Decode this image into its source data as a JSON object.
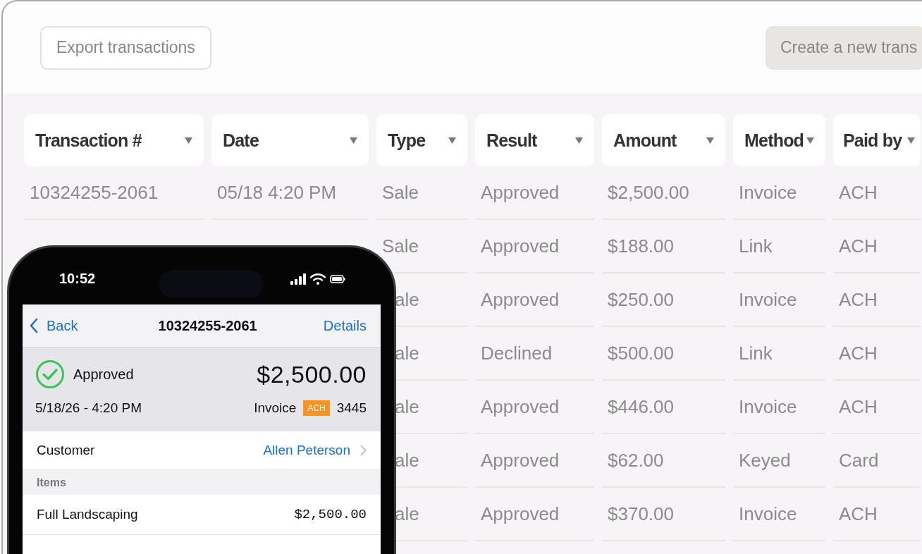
{
  "toolbar": {
    "buttons": [
      {
        "label": "Export transactions",
        "kind": "outline"
      },
      {
        "label": "Create a new trans",
        "kind": "filled"
      }
    ]
  },
  "table": {
    "columns": [
      "Transaction #",
      "Date",
      "Type",
      "Result",
      "Amount",
      "Method",
      "Paid by"
    ],
    "rows": [
      {
        "transaction": "10324255-2061",
        "date": "05/18 4:20 PM",
        "type": "Sale",
        "result": "Approved",
        "amount": "$2,500.00",
        "method": "Invoice",
        "paid_by": "ACH"
      },
      {
        "type": "Sale",
        "result": "Approved",
        "amount": "$188.00",
        "method": "Link",
        "paid_by": "ACH"
      },
      {
        "type": "ale",
        "result": "Approved",
        "amount": "$250.00",
        "method": "Invoice",
        "paid_by": "ACH"
      },
      {
        "type": "ale",
        "result": "Declined",
        "amount": "$500.00",
        "method": "Link",
        "paid_by": "ACH"
      },
      {
        "type": "ale",
        "result": "Approved",
        "amount": "$446.00",
        "method": "Invoice",
        "paid_by": "ACH"
      },
      {
        "type": "ale",
        "result": "Approved",
        "amount": "$62.00",
        "method": "Keyed",
        "paid_by": "Card"
      },
      {
        "type": "ale",
        "result": "Approved",
        "amount": "$370.00",
        "method": "Invoice",
        "paid_by": "ACH"
      }
    ]
  },
  "phone": {
    "time": "10:52",
    "nav": {
      "back": "Back",
      "title": "10324255-2061",
      "action": "Details"
    },
    "summary": {
      "status": "Approved",
      "amount": "$2,500.00",
      "date": "5/18/26 - 4:20 PM",
      "method": "Invoice",
      "badge": "ACH",
      "number": "3445"
    },
    "customer": {
      "label": "Customer",
      "value": "Allen Peterson"
    },
    "items_header": "Items",
    "items": [
      {
        "name": "Full Landscaping",
        "price": "$2,500.00"
      }
    ]
  }
}
